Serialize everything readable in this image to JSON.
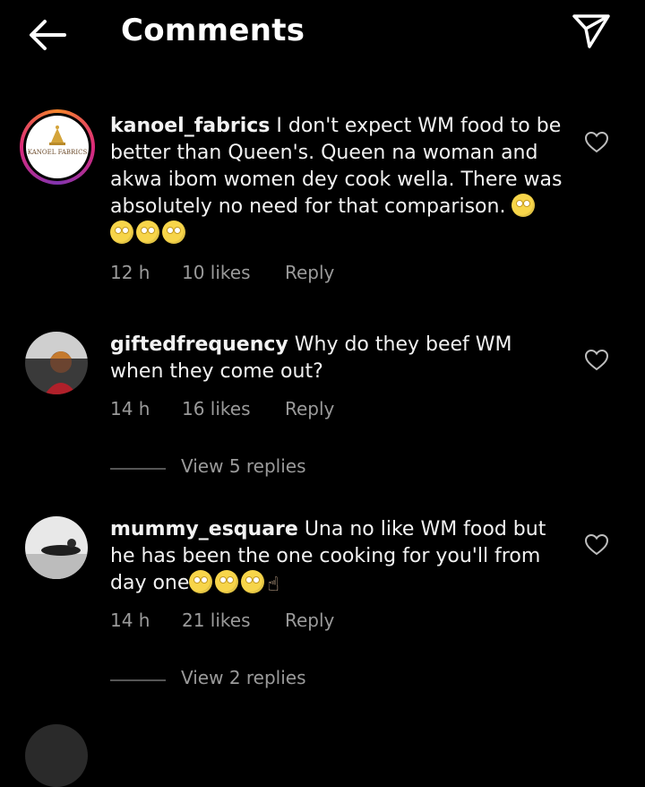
{
  "header": {
    "title": "Comments",
    "back_icon": "arrow-left-icon",
    "send_icon": "send-icon"
  },
  "comments": [
    {
      "username": "kanoel_fabrics",
      "avatar_text": "KANOEL FABRICS",
      "text": " I don't expect WM food to be better than Queen's. Queen na woman and akwa ibom women dey cook wella. There was absolutely no need for that comparison.",
      "time": "12 h",
      "likes": "10 likes",
      "reply": "Reply"
    },
    {
      "username": "giftedfrequency",
      "text": " Why do they beef WM when they come out?",
      "time": "14 h",
      "likes": "16 likes",
      "reply": "Reply",
      "view_replies": "View 5 replies"
    },
    {
      "username": "mummy_esquare",
      "text": " Una no like WM food but he has been the one cooking for you'll from day one",
      "time": "14 h",
      "likes": "21 likes",
      "reply": "Reply",
      "view_replies": "View 2 replies"
    }
  ],
  "colors": {
    "background": "#000000",
    "muted": "#9a9a9a",
    "story_ring": "#dd2a7b"
  }
}
